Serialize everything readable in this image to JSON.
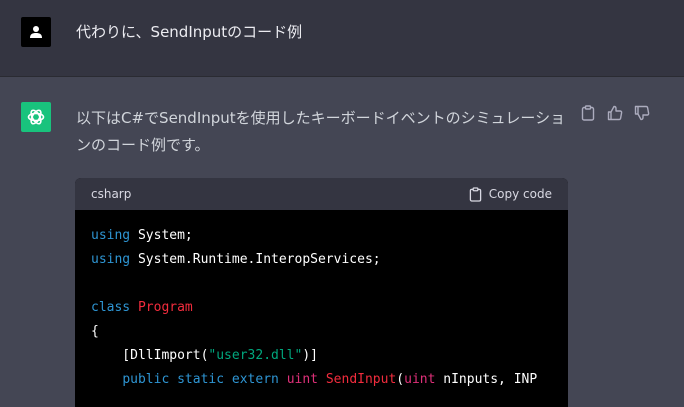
{
  "user_message": {
    "text": "代わりに、SendInputのコード例"
  },
  "assistant_message": {
    "text": "以下はC#でSendInputを使用したキーボードイベントのシミュレーションのコード例です。",
    "actions": [
      "copy-icon",
      "thumbs-up-icon",
      "thumbs-down-icon"
    ]
  },
  "code_block": {
    "language": "csharp",
    "copy_label": "Copy code",
    "lines": [
      [
        {
          "t": "using",
          "c": "kw"
        },
        {
          "t": " System;",
          "c": "plain"
        }
      ],
      [
        {
          "t": "using",
          "c": "kw"
        },
        {
          "t": " System.Runtime.InteropServices;",
          "c": "plain"
        }
      ],
      [],
      [
        {
          "t": "class",
          "c": "kw"
        },
        {
          "t": " ",
          "c": "plain"
        },
        {
          "t": "Program",
          "c": "cls"
        }
      ],
      [
        {
          "t": "{",
          "c": "plain"
        }
      ],
      [
        {
          "t": "    [DllImport(",
          "c": "plain"
        },
        {
          "t": "\"user32.dll\"",
          "c": "str"
        },
        {
          "t": ")]",
          "c": "plain"
        }
      ],
      [
        {
          "t": "    ",
          "c": "plain"
        },
        {
          "t": "public",
          "c": "kw"
        },
        {
          "t": " ",
          "c": "plain"
        },
        {
          "t": "static",
          "c": "kw"
        },
        {
          "t": " ",
          "c": "plain"
        },
        {
          "t": "extern",
          "c": "kw"
        },
        {
          "t": " ",
          "c": "plain"
        },
        {
          "t": "uint",
          "c": "typ"
        },
        {
          "t": " ",
          "c": "plain"
        },
        {
          "t": "SendInput",
          "c": "cls"
        },
        {
          "t": "(",
          "c": "plain"
        },
        {
          "t": "uint",
          "c": "typ"
        },
        {
          "t": " nInputs, INP",
          "c": "plain"
        }
      ]
    ]
  },
  "colors": {
    "user_bg": "#343541",
    "assistant_bg": "#444654",
    "bot_avatar": "#19c37d",
    "keyword": "#2e95d3",
    "class_name": "#f22c3d",
    "string": "#00a67d",
    "type": "#df3079"
  }
}
